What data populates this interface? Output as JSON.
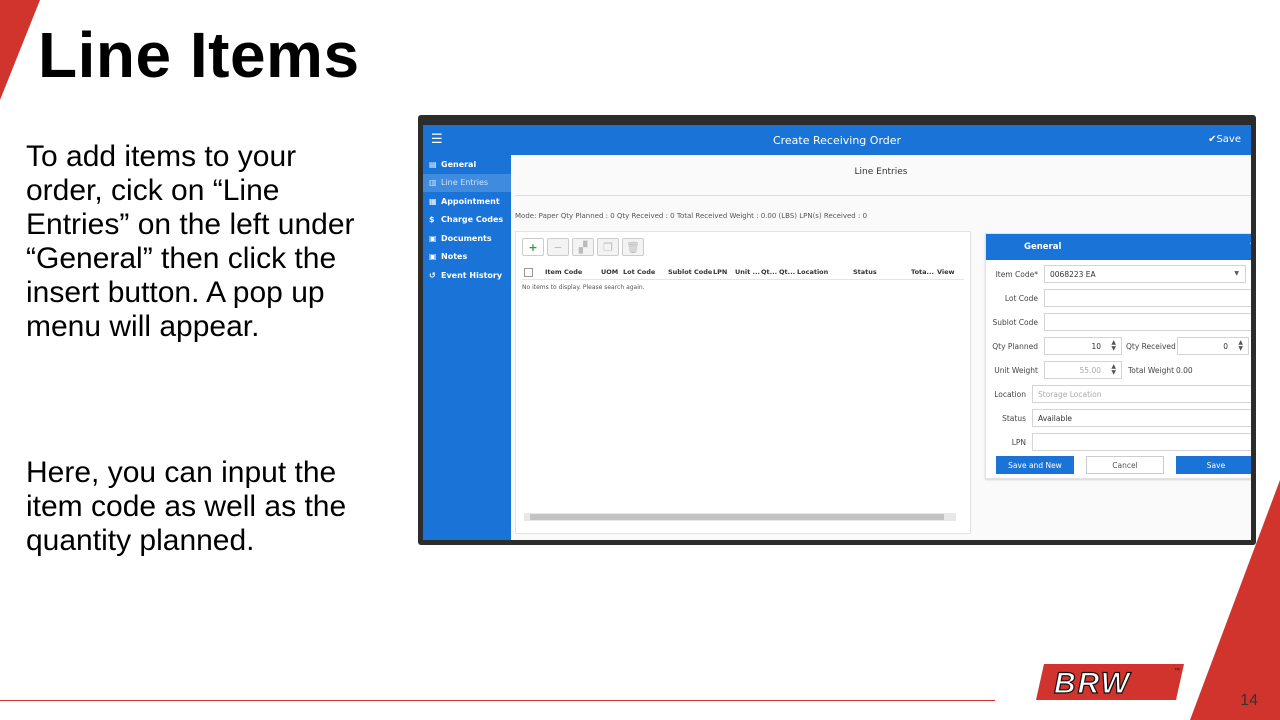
{
  "slide": {
    "title": "Line Items",
    "paragraph1": "To add items to your order, cick on “Line Entries” on the left under “General” then click the insert button. A pop up menu will appear.",
    "paragraph2": "Here, you can input the item code as well as the quantity planned.",
    "page_number": "14",
    "logo_text": "BRW",
    "accent_color": "#d0342c"
  },
  "app": {
    "title": "Create Receiving Order",
    "save_label": "✔Save",
    "sidebar": [
      {
        "label": "General",
        "icon": "id-card-icon"
      },
      {
        "label": "Line Entries",
        "icon": "trash-icon"
      },
      {
        "label": "Appointment",
        "icon": "calendar-icon"
      },
      {
        "label": "Charge Codes",
        "icon": "dollar-icon"
      },
      {
        "label": "Documents",
        "icon": "document-icon"
      },
      {
        "label": "Notes",
        "icon": "note-icon"
      },
      {
        "label": "Event History",
        "icon": "history-icon"
      }
    ],
    "panel_title": "Line Entries",
    "summary": "Mode: Paper   Qty Planned : 0   Qty Received : 0   Total Received Weight : 0.00 (LBS)   LPN(s) Received : 0",
    "grid": {
      "columns": [
        "Item Code",
        "UOM",
        "Lot Code",
        "Sublot Code",
        "LPN",
        "Unit ...",
        "Qt...",
        "Qt...",
        "Location",
        "Status",
        "Tota...",
        "View"
      ],
      "empty_message": "No items to display. Please search again."
    },
    "form": {
      "title": "General",
      "item_code_label": "Item Code*",
      "item_code_value": "0068223 EA",
      "lot_code_label": "Lot Code",
      "sublot_code_label": "Sublot Code",
      "qty_planned_label": "Qty Planned",
      "qty_planned_value": "10",
      "qty_received_label": "Qty Received",
      "qty_received_value": "0",
      "unit_weight_label": "Unit Weight",
      "unit_weight_value": "55.00",
      "total_weight_label": "Total Weight",
      "total_weight_value": "0.00",
      "location_label": "Location",
      "location_placeholder": "Storage Location",
      "status_label": "Status",
      "status_value": "Available",
      "lpn_label": "LPN",
      "save_and_new_label": "Save and New",
      "cancel_label": "Cancel",
      "save_label": "Save"
    }
  }
}
